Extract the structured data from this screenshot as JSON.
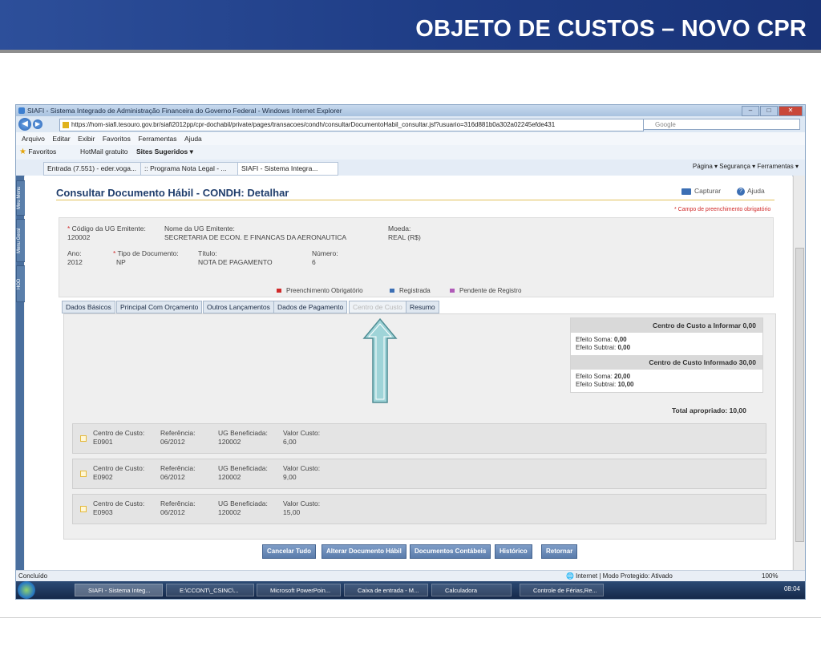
{
  "slide": {
    "title": "OBJETO DE CUSTOS – NOVO CPR"
  },
  "browser": {
    "window_title": "SIAFI - Sistema Integrado de Administração Financeira do Governo Federal - Windows Internet Explorer",
    "url": "https://hom-siafi.tesouro.gov.br/siafi2012pp/cpr-dochabil/private/pages/transacoes/condh/consultarDocumentoHabil_consultar.jsf?usuario=316d881b0a302a02245efde431",
    "search_placeholder": "Google",
    "menu": [
      "Arquivo",
      "Editar",
      "Exibir",
      "Favoritos",
      "Ferramentas",
      "Ajuda"
    ],
    "favorites_label": "Favoritos",
    "fav_links": [
      "HotMail gratuito",
      "Sites Sugeridos ▾"
    ],
    "tabs": [
      "Entrada (7.551) - eder.voga...",
      ":: Programa Nota Legal - ...",
      "SIAFI - Sistema Integra..."
    ],
    "command_bar": "Página ▾  Segurança ▾  Ferramentas ▾",
    "side_tabs": [
      "Meu Menu",
      "Menu Geral",
      "HOD"
    ],
    "status_left": "Concluído",
    "status_zone": "Internet | Modo Protegido: Ativado",
    "zoom": "100%"
  },
  "page": {
    "title": "Consultar Documento Hábil - CONDH: Detalhar",
    "capturar": "Capturar",
    "ajuda": "Ajuda",
    "required_note": "* Campo de preenchimento obrigatório",
    "header": {
      "codigo_ug_label": "Código da UG Emitente:",
      "codigo_ug_value": "120002",
      "nome_ug_label": "Nome da UG Emitente:",
      "nome_ug_value": "SECRETARIA DE ECON. E FINANCAS DA AERONAUTICA",
      "moeda_label": "Moeda:",
      "moeda_value": "REAL (R$)",
      "ano_label": "Ano:",
      "ano_value": "2012",
      "tipo_label": "Tipo de Documento:",
      "tipo_value": "NP",
      "titulo_label": "Título:",
      "titulo_value": "NOTA DE PAGAMENTO",
      "numero_label": "Número:",
      "numero_value": "6"
    },
    "legend": {
      "obrigatorio": "Preenchimento Obrigatório",
      "registrada": "Registrada",
      "pendente": "Pendente de Registro"
    },
    "tabs": [
      "Dados Básicos",
      "Principal Com Orçamento",
      "Outros Lançamentos",
      "Dados de Pagamento",
      "Centro de Custo",
      "Resumo"
    ],
    "summary": {
      "informar_title": "Centro de Custo a Informar 0,00",
      "informar_soma_label": "Efeito Soma:",
      "informar_soma_value": "0,00",
      "informar_subtrai_label": "Efeito Subtrai:",
      "informar_subtrai_value": "0,00",
      "informado_title": "Centro de Custo Informado 30,00",
      "informado_soma_label": "Efeito Soma:",
      "informado_soma_value": "20,00",
      "informado_subtrai_label": "Efeito Subtrai:",
      "informado_subtrai_value": "10,00",
      "total": "Total apropriado: 10,00"
    },
    "cost_center_labels": {
      "centro": "Centro de Custo:",
      "referencia": "Referência:",
      "ug": "UG Beneficiada:",
      "valor": "Valor Custo:"
    },
    "cost_centers": [
      {
        "centro": "E0901",
        "referencia": "06/2012",
        "ug": "120002",
        "valor": "6,00"
      },
      {
        "centro": "E0902",
        "referencia": "06/2012",
        "ug": "120002",
        "valor": "9,00"
      },
      {
        "centro": "E0903",
        "referencia": "06/2012",
        "ug": "120002",
        "valor": "15,00"
      }
    ],
    "buttons": [
      "Cancelar Tudo",
      "Alterar Documento Hábil",
      "Documentos Contábeis",
      "Histórico",
      "Retornar"
    ]
  },
  "taskbar": {
    "items": [
      "SIAFI - Sistema Integ...",
      "E:\\CCONT\\_CSINC\\...",
      "Microsoft PowerPoin...",
      "Caixa de entrada - M...",
      "Calculadora",
      "Controle de Férias,Re..."
    ],
    "clock": "08:04"
  },
  "colors": {
    "header_blue": "#1e3c85",
    "title_blue": "#1f3d6b",
    "button_blue": "#5a7cab",
    "required_red": "#d02a2a",
    "arrow_teal": "#9fd4d8"
  }
}
